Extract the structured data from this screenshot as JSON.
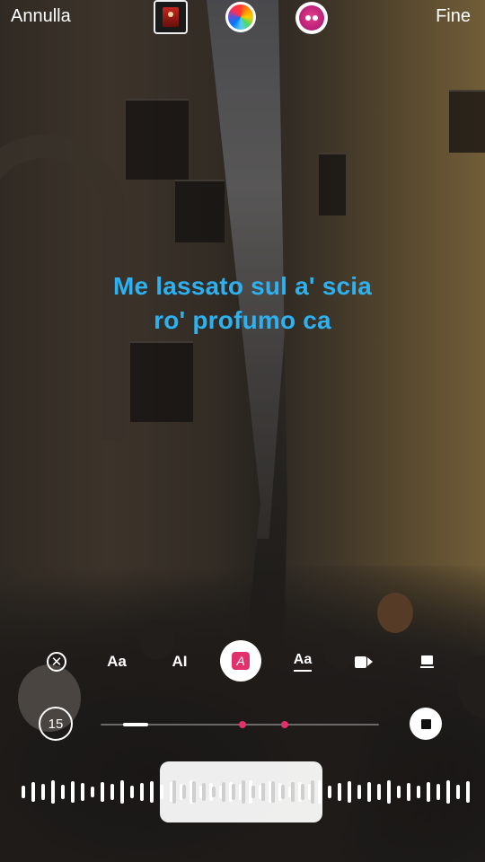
{
  "topbar": {
    "cancel_label": "Annulla",
    "done_label": "Fine",
    "album_icon": "album-cover-icon",
    "color_icon": "color-wheel-icon",
    "sticker_icon": "face-sticker-icon"
  },
  "lyrics": {
    "line1": "Me lassato sul a' scia",
    "line2": "ro' profumo ca",
    "color": "#2db1f0"
  },
  "toolbar": {
    "aa_label": "Aa",
    "ai_label": "AI",
    "active_label": "A",
    "aa_underline_label": "Aa",
    "accent_color": "#e1306c"
  },
  "duration": {
    "seconds": "15",
    "progress_fraction": 0.17,
    "markers": [
      0.51,
      0.66
    ]
  }
}
